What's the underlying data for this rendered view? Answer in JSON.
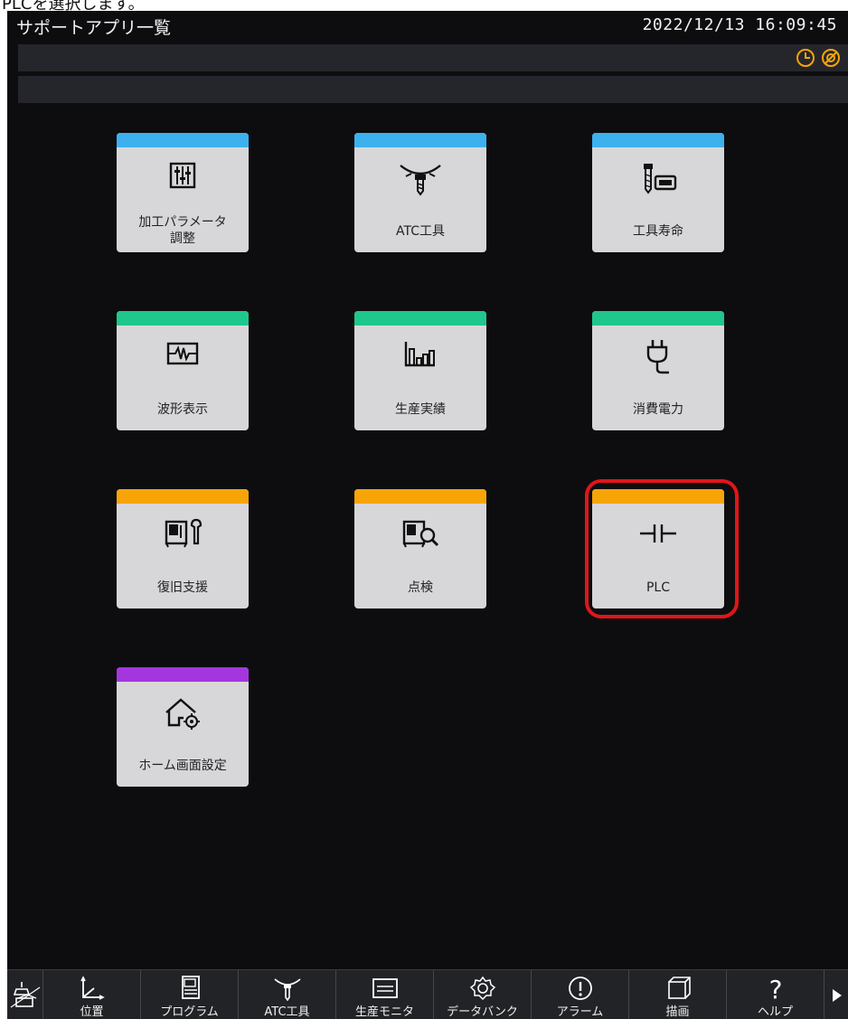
{
  "caption": "PLCを選択します。",
  "header": {
    "title": "サポートアプリ一覧",
    "datetime": "2022/12/13 16:09:45",
    "status_icons": [
      "clock-icon",
      "sync-icon"
    ]
  },
  "colors": {
    "blue": "#3db1ee",
    "green": "#1fc78c",
    "orange": "#f7a409",
    "purple": "#a436e0",
    "highlight": "#e0161a"
  },
  "tiles": [
    {
      "label": "加工パラメータ\n調整",
      "icon": "sliders-icon",
      "color": "blue"
    },
    {
      "label": "ATC工具",
      "icon": "atc-tool-icon",
      "color": "blue"
    },
    {
      "label": "工具寿命",
      "icon": "tool-life-icon",
      "color": "blue"
    },
    {
      "label": "波形表示",
      "icon": "waveform-icon",
      "color": "green"
    },
    {
      "label": "生産実績",
      "icon": "bar-chart-icon",
      "color": "green"
    },
    {
      "label": "消費電力",
      "icon": "plug-icon",
      "color": "green"
    },
    {
      "label": "復旧支援",
      "icon": "recovery-icon",
      "color": "orange"
    },
    {
      "label": "点検",
      "icon": "inspection-icon",
      "color": "orange"
    },
    {
      "label": "PLC",
      "icon": "plc-contact-icon",
      "color": "orange",
      "highlighted": true
    },
    {
      "label": "ホーム画面設定",
      "icon": "home-settings-icon",
      "color": "purple"
    }
  ],
  "bottom_nav": [
    {
      "label": "",
      "icon": "lamp-toolbox-icon"
    },
    {
      "label": "位置",
      "icon": "position-axes-icon"
    },
    {
      "label": "プログラム",
      "icon": "program-icon"
    },
    {
      "label": "ATC工具",
      "icon": "atc-tool-icon"
    },
    {
      "label": "生産モニタ",
      "icon": "monitor-icon"
    },
    {
      "label": "データバンク",
      "icon": "gear-icon"
    },
    {
      "label": "アラーム",
      "icon": "alarm-icon"
    },
    {
      "label": "描画",
      "icon": "cube-icon"
    },
    {
      "label": "ヘルプ",
      "icon": "help-icon"
    },
    {
      "label": "",
      "icon": "next-arrow-icon"
    }
  ]
}
